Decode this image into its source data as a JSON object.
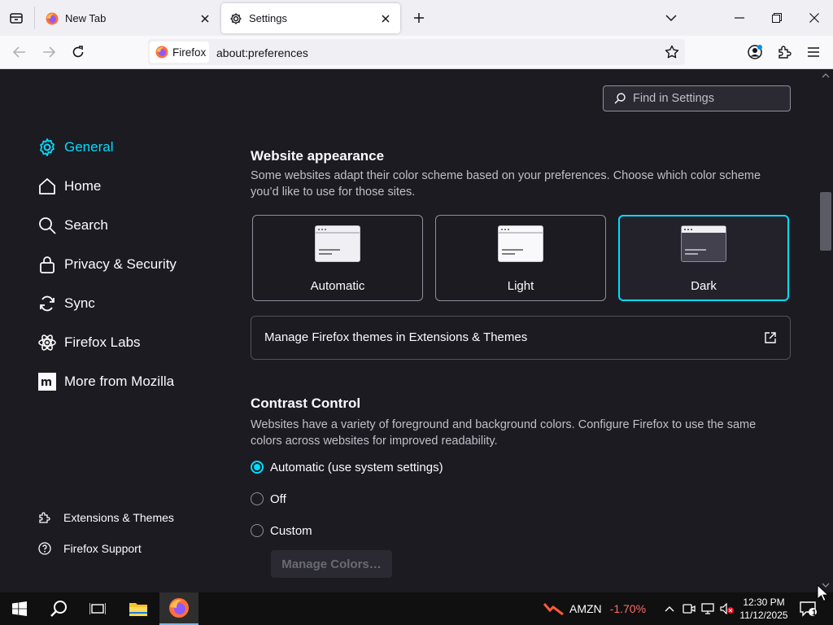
{
  "browser": {
    "tabs": [
      {
        "label": "New Tab",
        "active": false
      },
      {
        "label": "Settings",
        "active": true
      }
    ],
    "identity_label": "Firefox",
    "url": "about:preferences"
  },
  "settings": {
    "search_placeholder": "Find in Settings",
    "nav": [
      {
        "label": "General",
        "icon": "gear-icon",
        "selected": true
      },
      {
        "label": "Home",
        "icon": "home-icon"
      },
      {
        "label": "Search",
        "icon": "search-icon"
      },
      {
        "label": "Privacy & Security",
        "icon": "lock-icon"
      },
      {
        "label": "Sync",
        "icon": "sync-icon"
      },
      {
        "label": "Firefox Labs",
        "icon": "labs-icon"
      },
      {
        "label": "More from Mozilla",
        "icon": "mozilla-icon"
      }
    ],
    "footer": [
      {
        "label": "Extensions & Themes",
        "icon": "puzzle-icon"
      },
      {
        "label": "Firefox Support",
        "icon": "help-icon"
      }
    ],
    "website_appearance": {
      "title": "Website appearance",
      "description": "Some websites adapt their color scheme based on your preferences. Choose which color scheme you’d like to use for those sites.",
      "options": [
        {
          "label": "Automatic",
          "selected": false
        },
        {
          "label": "Light",
          "selected": false
        },
        {
          "label": "Dark",
          "selected": true
        }
      ],
      "manage_themes_label": "Manage Firefox themes in Extensions & Themes"
    },
    "contrast_control": {
      "title": "Contrast Control",
      "description": "Websites have a variety of foreground and background colors. Configure Firefox to use the same colors across websites for improved readability.",
      "options": [
        {
          "label": "Automatic (use system settings)",
          "selected": true
        },
        {
          "label": "Off",
          "selected": false
        },
        {
          "label": "Custom",
          "selected": false
        }
      ],
      "manage_colors_label": "Manage Colors…"
    }
  },
  "taskbar": {
    "stock_ticker": "AMZN",
    "stock_change": "-1.70%",
    "time": "12:30 PM",
    "date": "11/12/2025",
    "notification_count": "1"
  },
  "colors": {
    "accent": "#00ddff",
    "page_bg": "#1c1b22",
    "stock_negative": "#ff6b6b"
  }
}
